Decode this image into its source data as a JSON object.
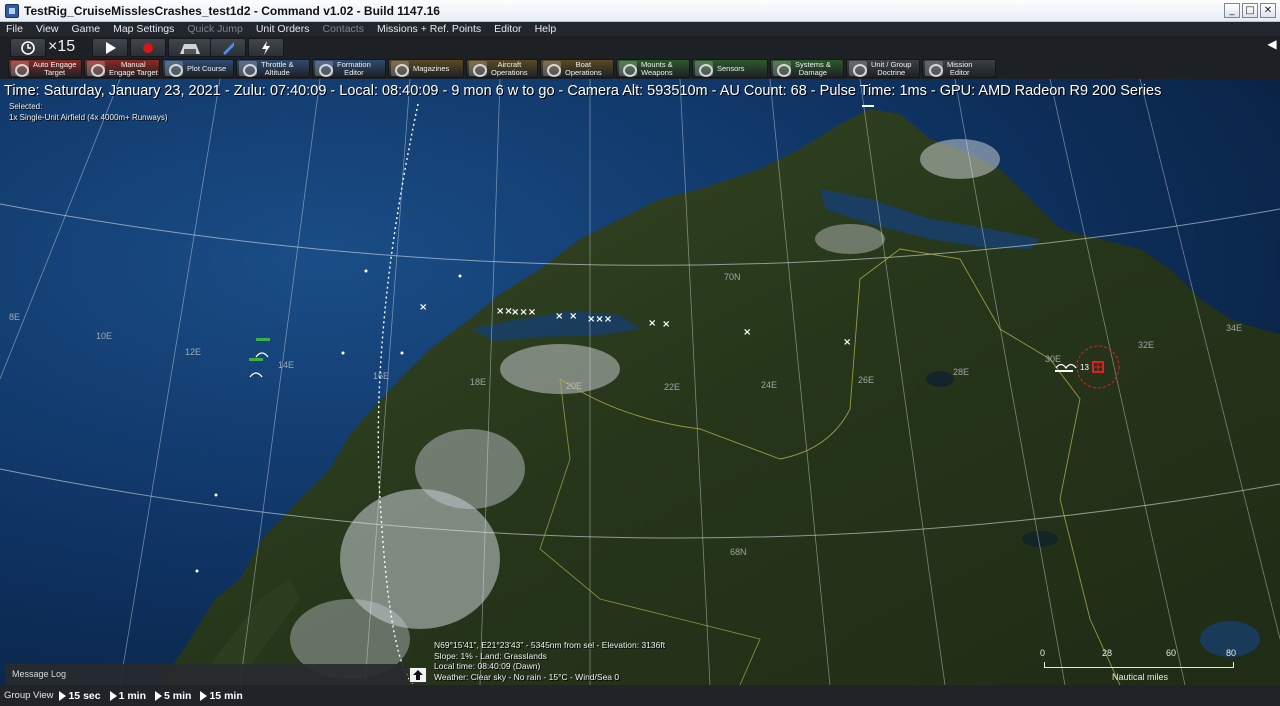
{
  "window": {
    "title": "TestRig_CruiseMisslesCrashes_test1d2 - Command v1.02 - Build 1147.16",
    "buttons": [
      "_",
      "□",
      "✕"
    ]
  },
  "menu": [
    {
      "label": "File",
      "enabled": true
    },
    {
      "label": "View",
      "enabled": true
    },
    {
      "label": "Game",
      "enabled": true
    },
    {
      "label": "Map Settings",
      "enabled": true
    },
    {
      "label": "Quick Jump",
      "enabled": false
    },
    {
      "label": "Unit Orders",
      "enabled": true
    },
    {
      "label": "Contacts",
      "enabled": false
    },
    {
      "label": "Missions + Ref. Points",
      "enabled": true
    },
    {
      "label": "Editor",
      "enabled": true
    },
    {
      "label": "Help",
      "enabled": true
    }
  ],
  "controls": {
    "time_compression": "×15",
    "buttons": [
      {
        "name": "clock-button",
        "icon": "clock-icon"
      },
      {
        "name": "play-button",
        "icon": "play-icon"
      },
      {
        "name": "record-button",
        "icon": "record-icon"
      },
      {
        "name": "hangar-button",
        "icon": "hangar-icon"
      },
      {
        "name": "tool-button",
        "icon": "wrench-icon"
      },
      {
        "name": "lightning-button",
        "icon": "lightning-icon"
      }
    ]
  },
  "toolbar": [
    {
      "name": "auto-engage-target",
      "label": "Auto Engage\nTarget",
      "color": "#8a2a22",
      "icon": "crosshair-icon"
    },
    {
      "name": "manual-engage-target",
      "label": "Manual\nEngage Target",
      "color": "#8a2a22",
      "icon": "crosshair-icon"
    },
    {
      "name": "plot-course",
      "label": "Plot Course",
      "color": "#2f4a72",
      "icon": "compass-icon"
    },
    {
      "name": "throttle-altitude",
      "label": "Throttle &\nAltitude",
      "color": "#2f4a72",
      "icon": "gauge-icon"
    },
    {
      "name": "formation-editor",
      "label": "Formation\nEditor",
      "color": "#2f4a72",
      "icon": "formation-icon"
    },
    {
      "name": "magazines",
      "label": "Magazines",
      "color": "#5b4a24",
      "icon": "ammo-icon"
    },
    {
      "name": "aircraft-operations",
      "label": "Aircraft\nOperations",
      "color": "#5b4a24",
      "icon": "aircraft-icon"
    },
    {
      "name": "boat-operations",
      "label": "Boat\nOperations",
      "color": "#5b4a24",
      "icon": "boat-icon"
    },
    {
      "name": "mounts-weapons",
      "label": "Mounts &\nWeapons",
      "color": "#2b5a2b",
      "icon": "weapons-icon"
    },
    {
      "name": "sensors",
      "label": "Sensors",
      "color": "#2b5a2b",
      "icon": "radar-icon"
    },
    {
      "name": "systems-damage",
      "label": "Systems &\nDamage",
      "color": "#2b5a2b",
      "icon": "gear-icon"
    },
    {
      "name": "unit-group-doctrine",
      "label": "Unit / Group\nDoctrine",
      "color": "#3c4046",
      "icon": "document-icon"
    },
    {
      "name": "mission-editor",
      "label": "Mission\nEditor",
      "color": "#3c4046",
      "icon": "mission-icon"
    }
  ],
  "status": {
    "line": "Time: Saturday, January 23, 2021 - Zulu: 07:40:09 - Local: 08:40:09 - 9 mon 6 w to go -  Camera Alt: 593510m  - AU Count: 68 - Pulse Time: 1ms - GPU: AMD Radeon R9 200 Series",
    "selected_label": "Selected:",
    "selected_unit": "1x Single-Unit Airfield (4x 4000m+ Runways)"
  },
  "map": {
    "lat_labels": [
      "70N",
      "68N"
    ],
    "lon_labels": [
      "8E",
      "10E",
      "12E",
      "14E",
      "16E",
      "18E",
      "20E",
      "22E",
      "24E",
      "26E",
      "28E",
      "30E",
      "32E",
      "34E"
    ],
    "contact_count": "13"
  },
  "cursor_info": {
    "line1": "N69°15'41\", E21°23'43\" - 5345nm from sel - Elevation: 3136ft",
    "line2": "Slope: 1% - Land: Grasslands",
    "line3": "Local time: 08:40:09 (Dawn)",
    "line4": "Weather: Clear sky - No rain - 15°C - Wind/Sea 0"
  },
  "message_log": {
    "title": "Message Log"
  },
  "scale": {
    "ticks": [
      "0",
      "28",
      "60",
      "80"
    ],
    "unit": "Nautical miles"
  },
  "bottom": {
    "group_view": "Group View",
    "steps": [
      "15 sec",
      "1 min",
      "5 min",
      "15 min"
    ]
  },
  "colors": {
    "ocean": "#0d2c52",
    "land": "#2a3a1e",
    "snow": "#d7dbe0",
    "hostile": "#e02020"
  }
}
